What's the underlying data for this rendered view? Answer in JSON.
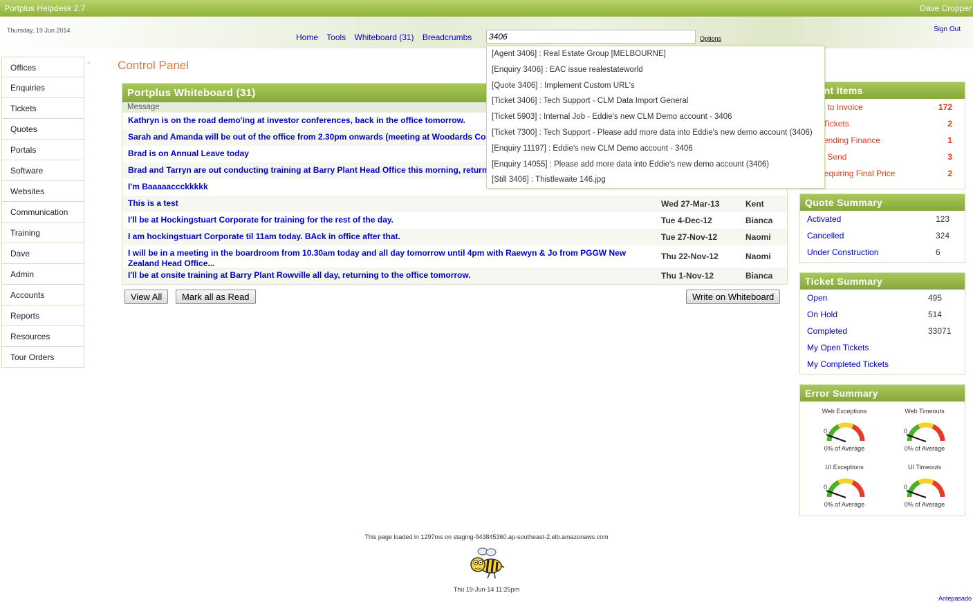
{
  "app": {
    "title": "Portplus Helpdesk 2.7",
    "user": "Dave Cropper"
  },
  "header": {
    "date": "Thursday, 19 Jun 2014",
    "sign_out": "Sign Out",
    "nav": [
      "Home",
      "Tools",
      "Whiteboard (31)",
      "Breadcrumbs"
    ],
    "search_value": "3406",
    "options": "Options"
  },
  "search_results": [
    "[Agent 3406] : Real Estate Group [MELBOURNE]",
    "[Enquiry 3406] : EAC issue realestateworld",
    "[Quote 3406] : Implement Custom URL's",
    "[Ticket 3406] : Tech Support - CLM Data Import General",
    "[Ticket 5903] : Internal Job - Eddie's new CLM Demo account - 3406",
    "[Ticket 7300] : Tech Support - Please add more data into Eddie's new demo account (3406)",
    "[Enquiry 11197] : Eddie's new CLM Demo account - 3406",
    "[Enquiry 14055] : Please add more data into Eddie's new demo account (3406)",
    "[Still 3406] : Thistlewaite 146.jpg"
  ],
  "sidebar": [
    "Offices",
    "Enquiries",
    "Tickets",
    "Quotes",
    "Portals",
    "Software",
    "Websites",
    "Communication",
    "Training",
    "Dave",
    "Admin",
    "Accounts",
    "Reports",
    "Resources",
    "Tour Orders"
  ],
  "sidebar_collapse": "«",
  "page_title": "Control Panel",
  "whiteboard": {
    "title": "Portplus Whiteboard (31)",
    "col_message": "Message",
    "rows": [
      {
        "msg": "Kathryn is on the road demo'ing at investor conferences, back in the office tomorrow.",
        "date": "",
        "who": ""
      },
      {
        "msg": "Sarah and Amanda will be out of the office from 2.30pm onwards (meeting at Woodards Cor",
        "date": "",
        "who": ""
      },
      {
        "msg": "Brad is on Annual Leave today",
        "date": "",
        "who": ""
      },
      {
        "msg": "Brad and Tarryn are out conducting training at Barry Plant Head Office this morning, returnin",
        "date": "",
        "who": ""
      },
      {
        "msg": "I'm Baaaaaccckkkkk",
        "date": "",
        "who": ""
      },
      {
        "msg": "This is a test",
        "date": "Wed 27-Mar-13",
        "who": "Kent"
      },
      {
        "msg": "I'll be at Hockingstuart Corporate for training for the rest of the day.",
        "date": "Tue 4-Dec-12",
        "who": "Bianca"
      },
      {
        "msg": "I am hockingstuart Corporate til 11am today. BAck in office after that.",
        "date": "Tue 27-Nov-12",
        "who": "Naomi"
      },
      {
        "msg": "I will be in a meeting in the boardroom from 10.30am today and all day tomorrow until 4pm with Raewyn & Jo from PGGW New Zealand Head Office...",
        "date": "Thu 22-Nov-12",
        "who": "Naomi"
      },
      {
        "msg": "I'll be at onsite training at Barry Plant Rowville all day, returning to the office tomorrow.",
        "date": "Thu 1-Nov-12",
        "who": "Bianca"
      }
    ],
    "buttons": {
      "view_all": "View All",
      "mark_read": "Mark all as Read",
      "write": "Write on Whiteboard"
    }
  },
  "important": {
    "title": "ortant Items",
    "rows": [
      {
        "label": "eady to Invoice",
        "value": "172"
      },
      {
        "label": "due Tickets",
        "value": "2"
      },
      {
        "label": "es Pending Finance",
        "value": "1"
      },
      {
        "label": "es to Send",
        "value": "3"
      },
      {
        "label": "es Requiring Final Price",
        "value": "2"
      }
    ]
  },
  "quote_summary": {
    "title": "Quote Summary",
    "rows": [
      {
        "label": "Activated",
        "value": "123"
      },
      {
        "label": "Cancelled",
        "value": "324"
      },
      {
        "label": "Under Construction",
        "value": "6"
      }
    ]
  },
  "ticket_summary": {
    "title": "Ticket Summary",
    "rows": [
      {
        "label": "Open",
        "value": "495"
      },
      {
        "label": "On Hold",
        "value": "514"
      },
      {
        "label": "Completed",
        "value": "33071"
      },
      {
        "label": "My Open Tickets",
        "value": ""
      },
      {
        "label": "My Completed Tickets",
        "value": ""
      }
    ]
  },
  "error_summary": {
    "title": "Error Summary",
    "gauges": [
      {
        "label": "Web Exceptions",
        "zero": "0",
        "pct": "0% of Average"
      },
      {
        "label": "Web Timeouts",
        "zero": "0",
        "pct": "0% of Average"
      },
      {
        "label": "UI Exceptions",
        "zero": "0",
        "pct": "0% of Average"
      },
      {
        "label": "UI Timeouts",
        "zero": "0",
        "pct": "0% of Average"
      }
    ]
  },
  "footer": {
    "loaded": "This page loaded in 1297ms on staging-943845360.ap-southeast-2.elb.amazonaws.com",
    "timestamp": "Thu 19-Jun-14 11:25pm",
    "antepasado": "Antepasado"
  },
  "colors": {
    "accent_green": "#8eb23a",
    "link_blue": "#0000cc",
    "title_orange": "#e07a3a",
    "alert_red": "#e03a1a"
  }
}
